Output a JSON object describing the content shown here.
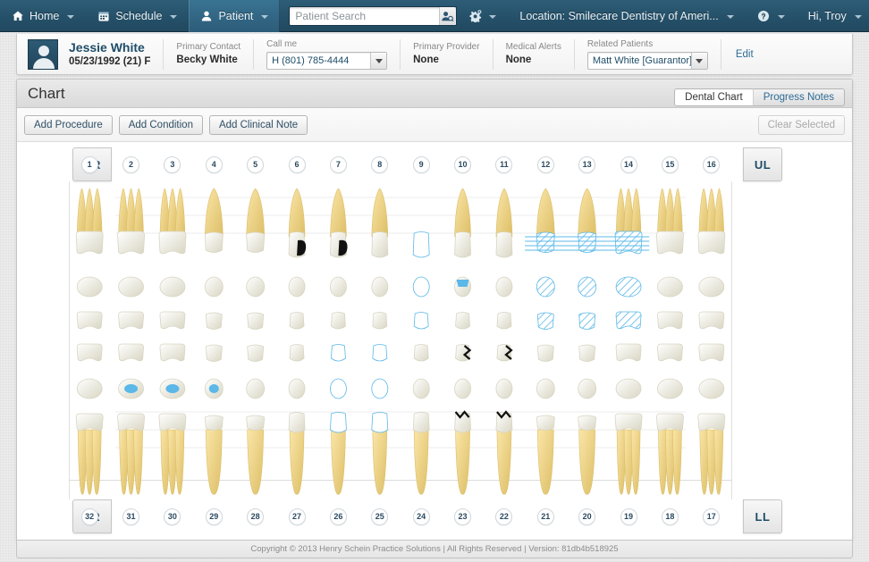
{
  "topnav": {
    "items": [
      {
        "label": "Home",
        "icon": "home-icon",
        "caret": true,
        "active": false
      },
      {
        "label": "Schedule",
        "icon": "calendar-icon",
        "caret": true,
        "active": false
      },
      {
        "label": "Patient",
        "icon": "person-icon",
        "caret": true,
        "active": true
      }
    ],
    "search": {
      "value": "",
      "placeholder": "Patient Search",
      "button_icon": "patient-search-icon"
    },
    "right_items": [
      {
        "label": "",
        "icon": "gear-icon",
        "caret": true
      },
      {
        "label": "Location: Smilecare Dentistry of Ameri...",
        "icon": "",
        "caret": true
      },
      {
        "label": "",
        "icon": "help-icon",
        "caret": true
      },
      {
        "label": "Hi,  Troy",
        "icon": "",
        "caret": true
      }
    ]
  },
  "patient": {
    "name": "Jessie White",
    "dob_line": "05/23/1992 (21) F",
    "primary_contact_label": "Primary Contact",
    "primary_contact_value": "Becky White",
    "call_me_label": "Call me",
    "call_me_value": "H (801) 785-4444",
    "primary_provider_label": "Primary Provider",
    "primary_provider_value": "None",
    "medical_alerts_label": "Medical Alerts",
    "medical_alerts_value": "None",
    "related_patients_label": "Related Patients",
    "related_patients_value": "Matt White [Guarantor]",
    "edit_label": "Edit"
  },
  "panel": {
    "title": "Chart",
    "tabs": [
      {
        "label": "Dental Chart",
        "active": true
      },
      {
        "label": "Progress Notes",
        "active": false
      }
    ],
    "toolbar": {
      "buttons": [
        {
          "label": "Add Procedure",
          "disabled": false
        },
        {
          "label": "Add Condition",
          "disabled": false
        },
        {
          "label": "Add Clinical Note",
          "disabled": false
        }
      ],
      "clear_selected": {
        "label": "Clear Selected",
        "disabled": true
      }
    }
  },
  "chart": {
    "quadrants": {
      "upper_right": "UR",
      "upper_left": "UL",
      "lower_right": "LR",
      "lower_left": "LL"
    },
    "upper_tooth_numbers": [
      1,
      2,
      3,
      4,
      5,
      6,
      7,
      8,
      9,
      10,
      11,
      12,
      13,
      14,
      15,
      16
    ],
    "lower_tooth_numbers": [
      32,
      31,
      30,
      29,
      28,
      27,
      26,
      25,
      24,
      23,
      22,
      21,
      20,
      19,
      18,
      17
    ],
    "colors": {
      "enamel": "#eceadb",
      "enamel_shadow": "#d8d5c2",
      "root": "#f2d88a",
      "root_shadow": "#dcbf6a",
      "existing_restoration": "#5bb8e8",
      "planned_outline": "#5bb8e8",
      "decay": "#111111",
      "gridline": "#ececec"
    },
    "markings": [
      {
        "tooth": 6,
        "type": "decay",
        "note": "distal decay"
      },
      {
        "tooth": 7,
        "type": "decay",
        "note": "mesial decay"
      },
      {
        "tooth": 9,
        "type": "planned-crown-outline"
      },
      {
        "tooth": 10,
        "type": "existing-restoration",
        "surface": "incisal"
      },
      {
        "tooth": 12,
        "type": "bridge-hatched"
      },
      {
        "tooth": 13,
        "type": "bridge-hatched"
      },
      {
        "tooth": 14,
        "type": "bridge-hatched"
      },
      {
        "tooth": 31,
        "type": "existing-restoration",
        "surface": "occlusal"
      },
      {
        "tooth": 30,
        "type": "existing-restoration",
        "surface": "occlusal"
      },
      {
        "tooth": 29,
        "type": "existing-restoration",
        "surface": "occlusal"
      },
      {
        "tooth": 26,
        "type": "planned-crown-outline"
      },
      {
        "tooth": 25,
        "type": "planned-crown-outline"
      },
      {
        "tooth": 23,
        "type": "fracture"
      },
      {
        "tooth": 22,
        "type": "fracture"
      }
    ]
  },
  "footer": {
    "text": "Copyright © 2013 Henry Schein Practice Solutions | All Rights Reserved | Version: 81db4b518925"
  }
}
